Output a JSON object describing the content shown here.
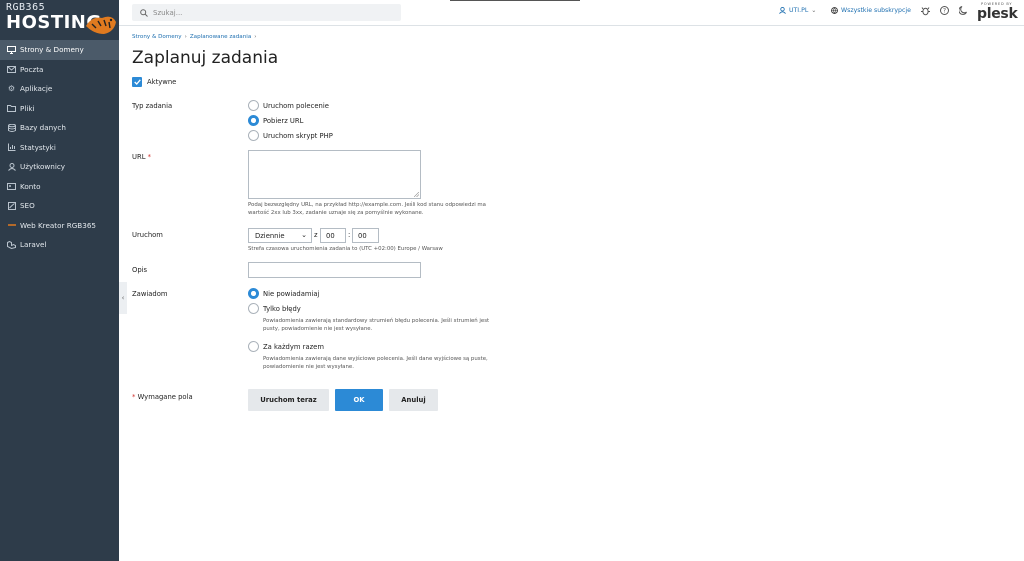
{
  "logo": {
    "line1": "RGB365",
    "line2": "HOSTING"
  },
  "sidebar": {
    "items": [
      {
        "label": "Strony & Domeny",
        "icon": "monitor-icon",
        "active": true
      },
      {
        "label": "Poczta",
        "icon": "mail-icon"
      },
      {
        "label": "Aplikacje",
        "icon": "gear-icon"
      },
      {
        "label": "Pliki",
        "icon": "folder-icon"
      },
      {
        "label": "Bazy danych",
        "icon": "database-icon"
      },
      {
        "label": "Statystyki",
        "icon": "chart-icon"
      },
      {
        "label": "Użytkownicy",
        "icon": "user-icon"
      },
      {
        "label": "Konto",
        "icon": "id-card-icon"
      },
      {
        "label": "SEO",
        "icon": "trend-icon"
      },
      {
        "label": "Web Kreator RGB365",
        "icon": "builder-icon"
      },
      {
        "label": "Laravel",
        "icon": "laravel-icon"
      }
    ]
  },
  "topbar": {
    "search_placeholder": "Szukaj...",
    "user": "UTI.PL",
    "subscriptions": "Wszystkie subskrypcje",
    "powered_by": "POWERED BY",
    "brand": "plesk"
  },
  "breadcrumb": [
    "Strony & Domeny",
    "Zaplanowane zadania"
  ],
  "page_title": "Zaplanuj zadania",
  "form": {
    "active_label": "Aktywne",
    "task_type_label": "Typ zadania",
    "task_type_options": [
      "Uruchom polecenie",
      "Pobierz URL",
      "Uruchom skrypt PHP"
    ],
    "task_type_selected": "Pobierz URL",
    "url_label": "URL",
    "url_required_mark": "*",
    "url_hint_1": "Podaj bezwzględny URL, na przykład http://example.com. Jeśli kod stanu odpowiedzi ma",
    "url_hint_2": "wartość 2xx lub 3xx, zadanie uznaje się za pomyślnie wykonane.",
    "run_label": "Uruchom",
    "run_frequency": "Dziennie",
    "run_at_word": "z",
    "run_hour": "00",
    "run_colon": ":",
    "run_minute": "00",
    "timezone_hint": "Strefa czasowa uruchomienia zadania to (UTC +02:00) Europe / Warsaw",
    "description_label": "Opis",
    "notify_label": "Zawiadom",
    "notify_options": [
      {
        "label": "Nie powiadamiaj",
        "hint": []
      },
      {
        "label": "Tylko błędy",
        "hint": [
          "Powiadomienia zawierają standardowy strumień błędu polecenia. Jeśli strumień jest",
          "pusty, powiadomienie nie jest wysyłane."
        ]
      },
      {
        "label": "Za każdym razem",
        "hint": [
          "Powiadomienia zawierają dane wyjściowe polecenia. Jeśli dane wyjściowe są puste,",
          "powiadomienie nie jest wysyłane."
        ]
      }
    ],
    "notify_selected": "Nie powiadamiaj",
    "required_note": "Wymagane pola",
    "buttons": {
      "run_now": "Uruchom teraz",
      "ok": "OK",
      "cancel": "Anuluj"
    }
  },
  "colors": {
    "sidebar": "#2e3c4a",
    "accent": "#2c8ad6",
    "link": "#1e6fb0"
  }
}
